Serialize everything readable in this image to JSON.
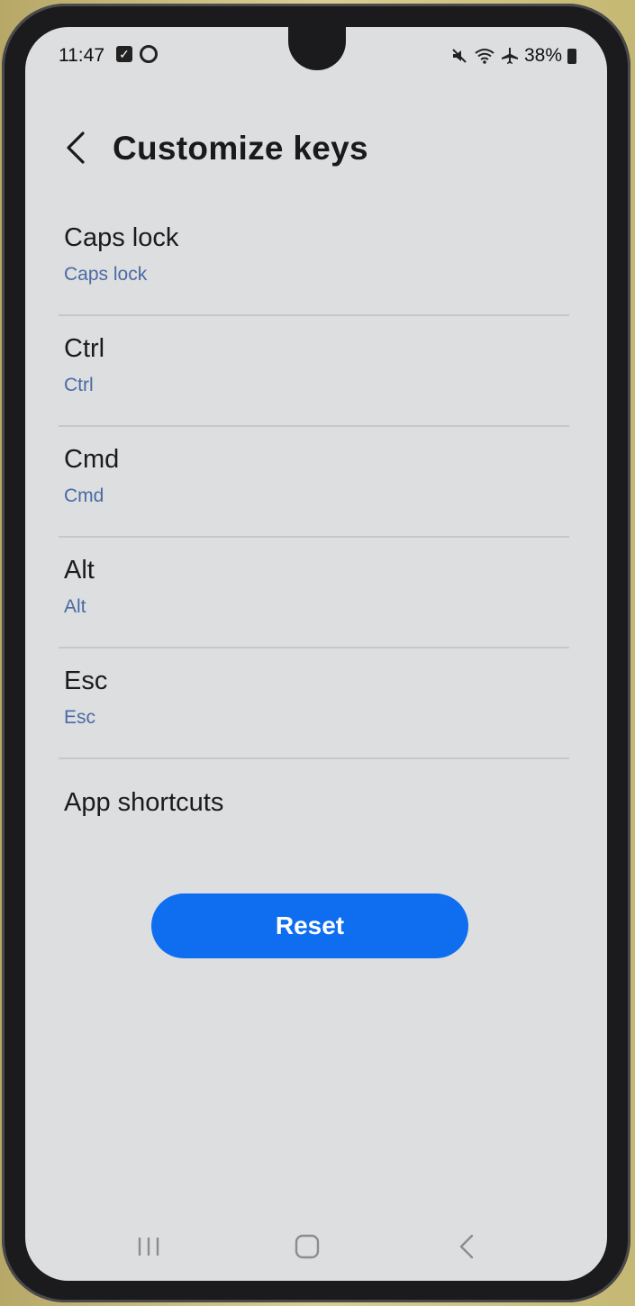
{
  "status_bar": {
    "time": "11:47",
    "battery": "38%",
    "icons": [
      "checkbox-notification-icon",
      "ring-notification-icon",
      "mute-icon",
      "wifi-icon",
      "airplane-icon",
      "battery-icon"
    ]
  },
  "header": {
    "title": "Customize keys",
    "back_icon": "chevron-left-icon"
  },
  "list": {
    "items": [
      {
        "title": "Caps lock",
        "subtitle": "Caps lock"
      },
      {
        "title": "Ctrl",
        "subtitle": "Ctrl"
      },
      {
        "title": "Cmd",
        "subtitle": "Cmd"
      },
      {
        "title": "Alt",
        "subtitle": "Alt"
      },
      {
        "title": "Esc",
        "subtitle": "Esc"
      }
    ],
    "app_shortcuts": "App shortcuts"
  },
  "reset_button": {
    "label": "Reset"
  },
  "colors": {
    "accent": "#0f6ef0",
    "subtitle": "#4a6aa3",
    "background": "#dcdee0"
  },
  "nav_bar": {
    "icons": [
      "recents-icon",
      "home-icon",
      "back-icon"
    ]
  }
}
